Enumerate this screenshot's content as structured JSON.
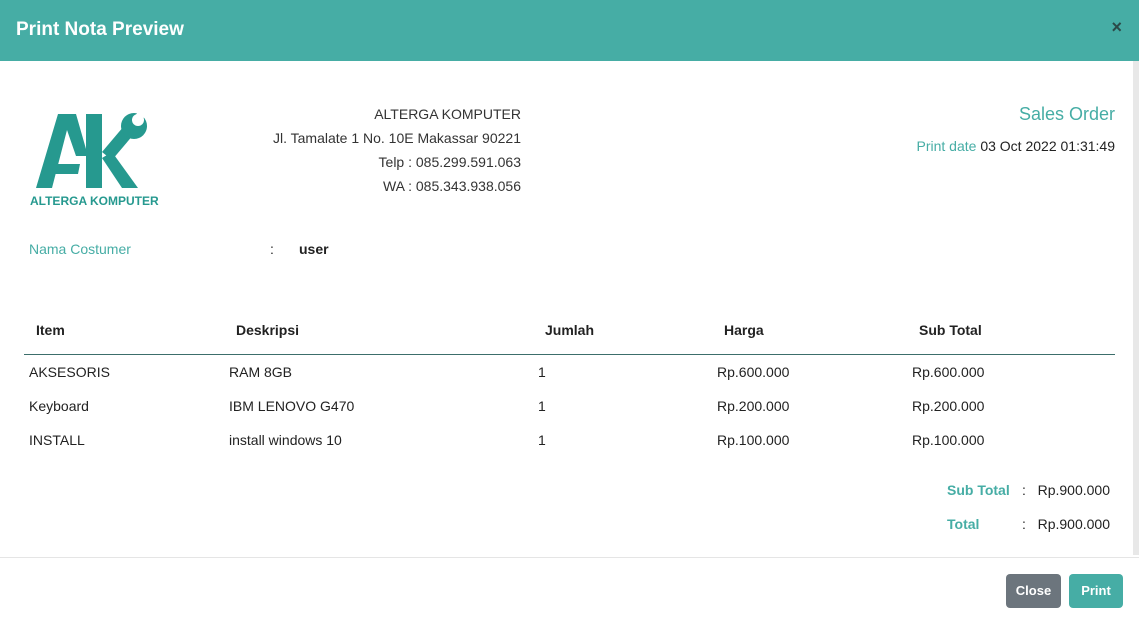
{
  "modal": {
    "title": "Print Nota Preview",
    "close_icon": "×"
  },
  "logo": {
    "initials": "AK",
    "text": "ALTERGA KOMPUTER",
    "color": "#26998f"
  },
  "company": {
    "name": "ALTERGA KOMPUTER",
    "address": "Jl. Tamalate 1 No. 10E Makassar 90221",
    "phone": "Telp : 085.299.591.063",
    "wa": "WA : 085.343.938.056"
  },
  "document": {
    "title": "Sales Order",
    "print_date_label": "Print date",
    "print_date_value": "03 Oct 2022 01:31:49"
  },
  "customer": {
    "label": "Nama Costumer",
    "colon": ":",
    "value": "user"
  },
  "table": {
    "headers": [
      "Item",
      "Deskripsi",
      "Jumlah",
      "Harga",
      "Sub Total"
    ],
    "rows": [
      [
        "AKSESORIS",
        "RAM 8GB",
        "1",
        "Rp.600.000",
        "Rp.600.000"
      ],
      [
        "Keyboard",
        "IBM LENOVO G470",
        "1",
        "Rp.200.000",
        "Rp.200.000"
      ],
      [
        "INSTALL",
        "install windows 10",
        "1",
        "Rp.100.000",
        "Rp.100.000"
      ]
    ]
  },
  "summary": {
    "subtotal_label": "Sub Total",
    "subtotal_colon": ":",
    "subtotal_value": "Rp.900.000",
    "total_label": "Total",
    "total_colon": ":",
    "total_value": "Rp.900.000"
  },
  "buttons": {
    "close": "Close",
    "print": "Print"
  },
  "colors": {
    "accent": "#46ada5",
    "secondary": "#6c757d"
  }
}
